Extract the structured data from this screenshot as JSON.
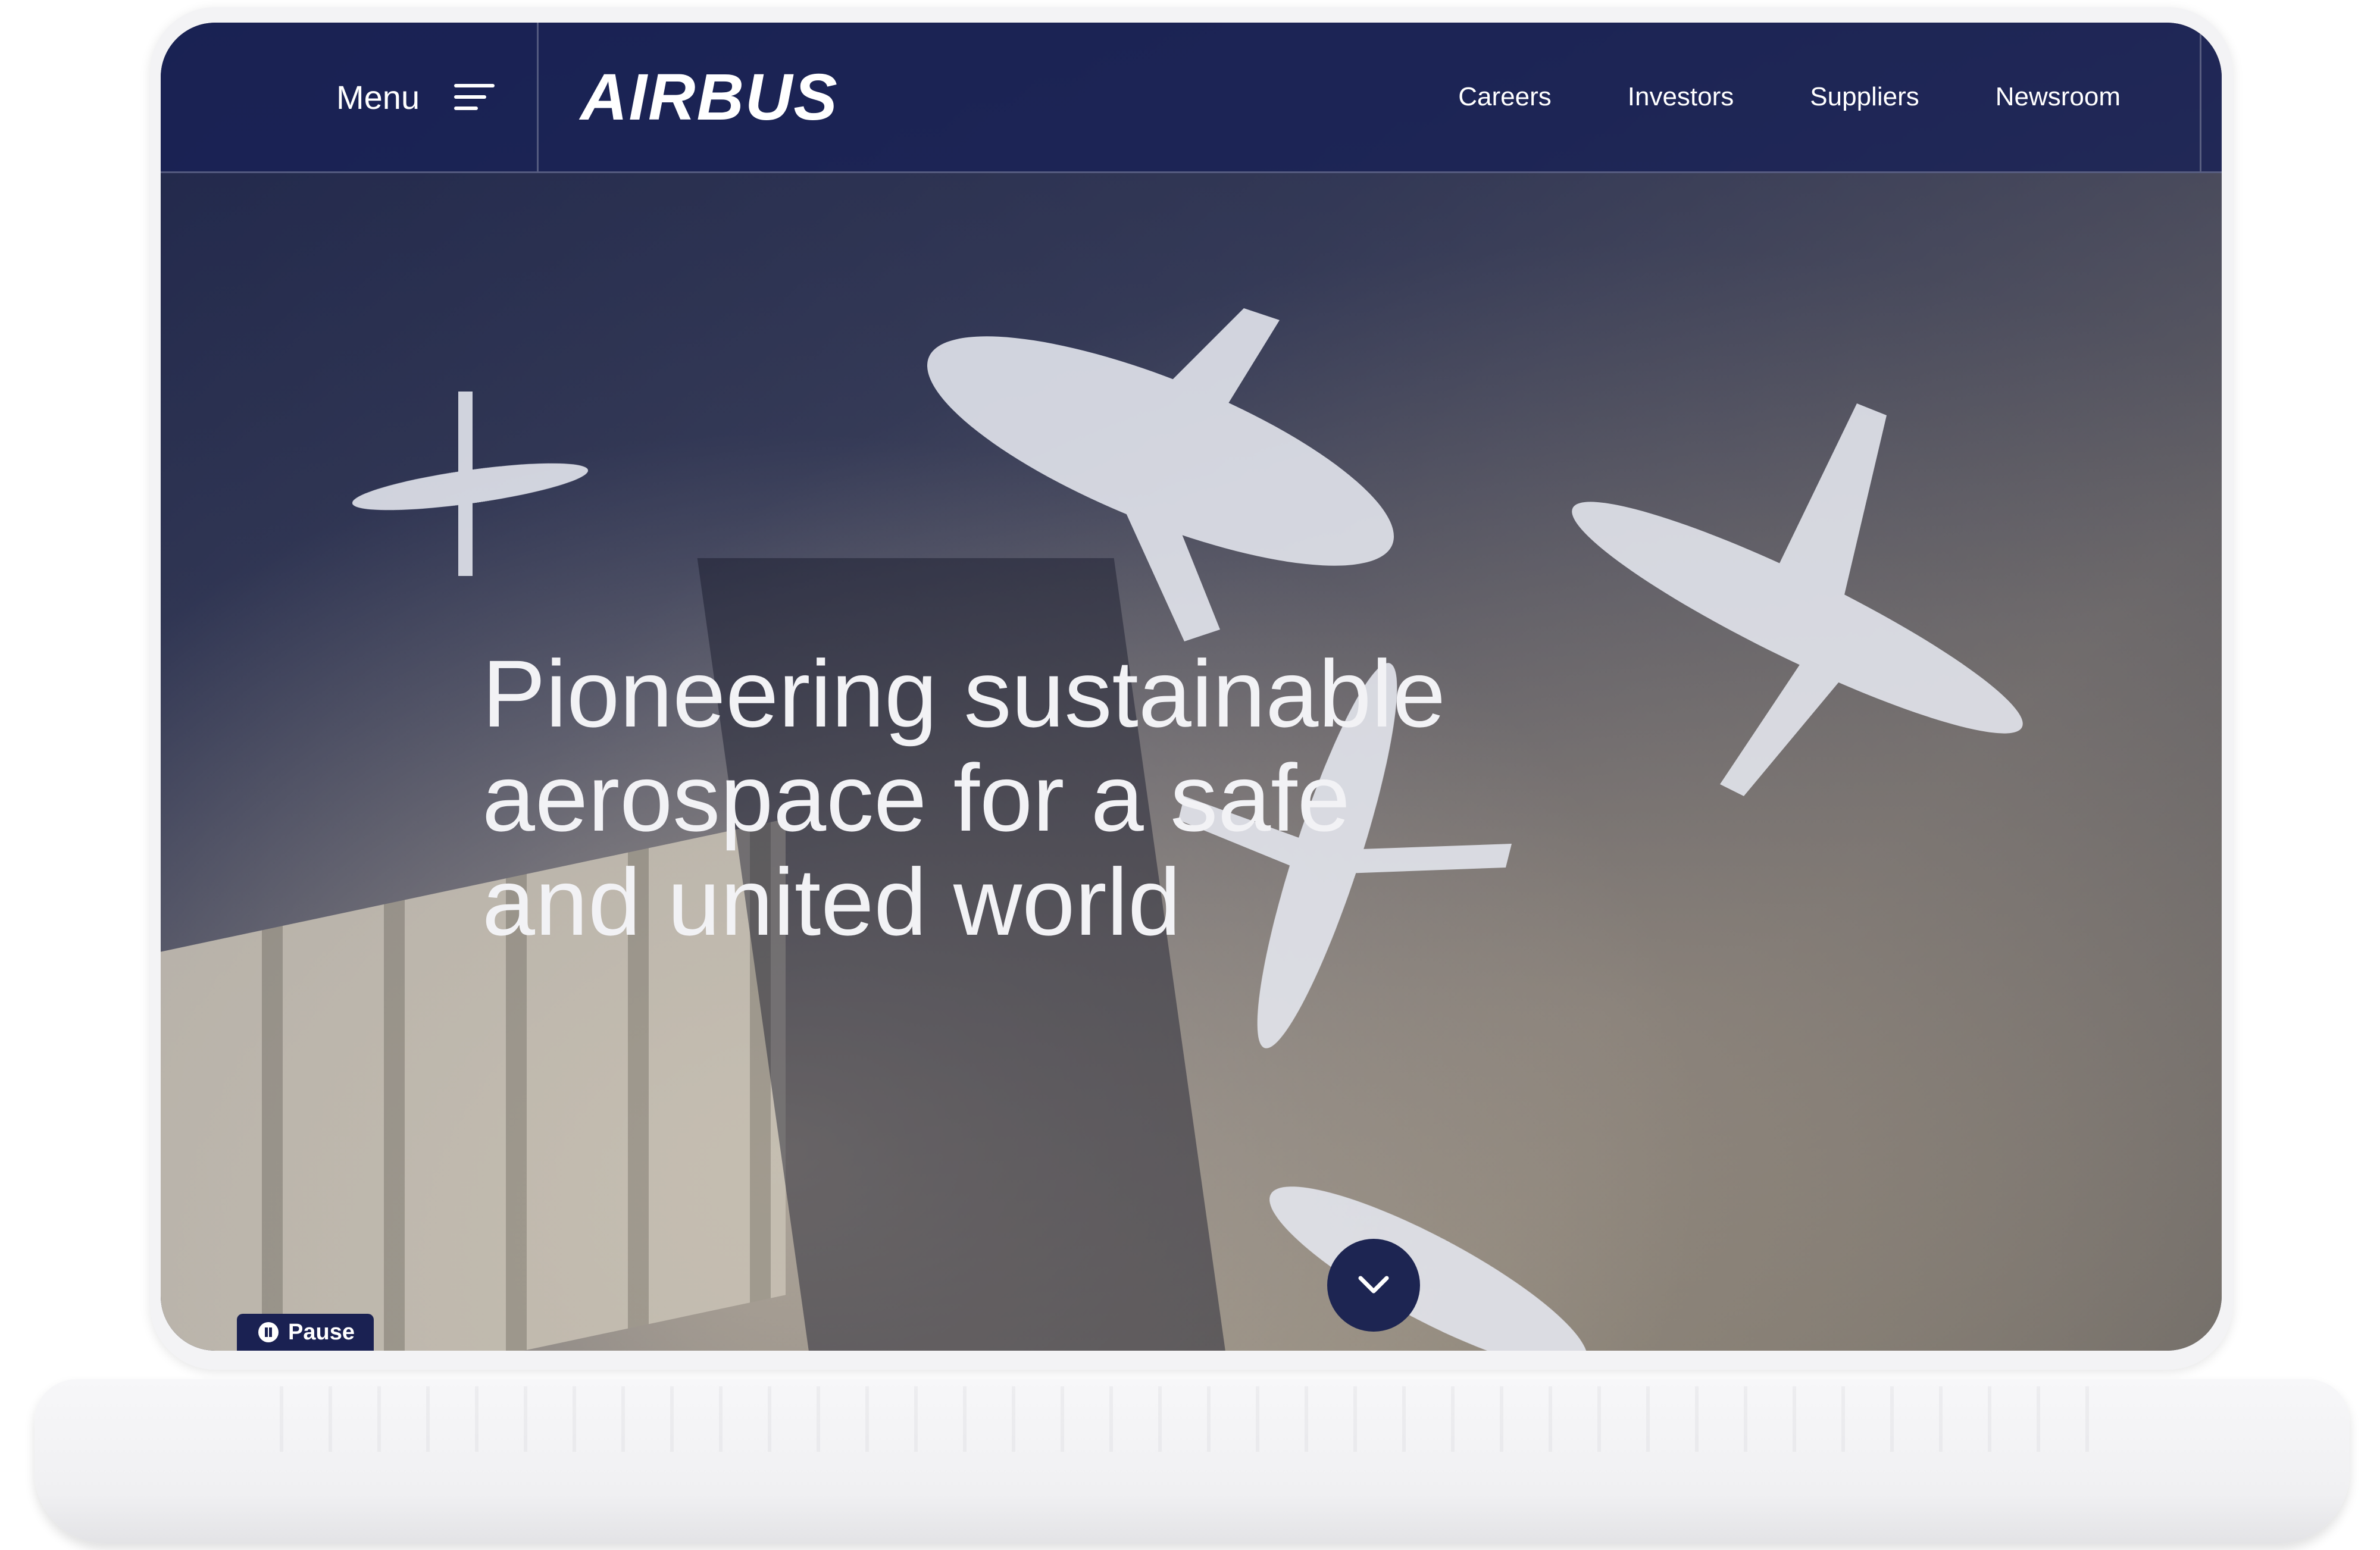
{
  "nav": {
    "menu_label": "Menu",
    "logo": "AIRBUS",
    "links": [
      "Careers",
      "Investors",
      "Suppliers",
      "Newsroom"
    ]
  },
  "hero": {
    "headline": "Pioneering sustainable aerospace for a safe and united world",
    "pause_label": "Pause"
  },
  "icons": {
    "menu": "hamburger-icon",
    "scroll": "chevron-down-icon",
    "pause": "pause-icon"
  },
  "colors": {
    "brand_navy": "#182156",
    "text": "#ffffff"
  }
}
